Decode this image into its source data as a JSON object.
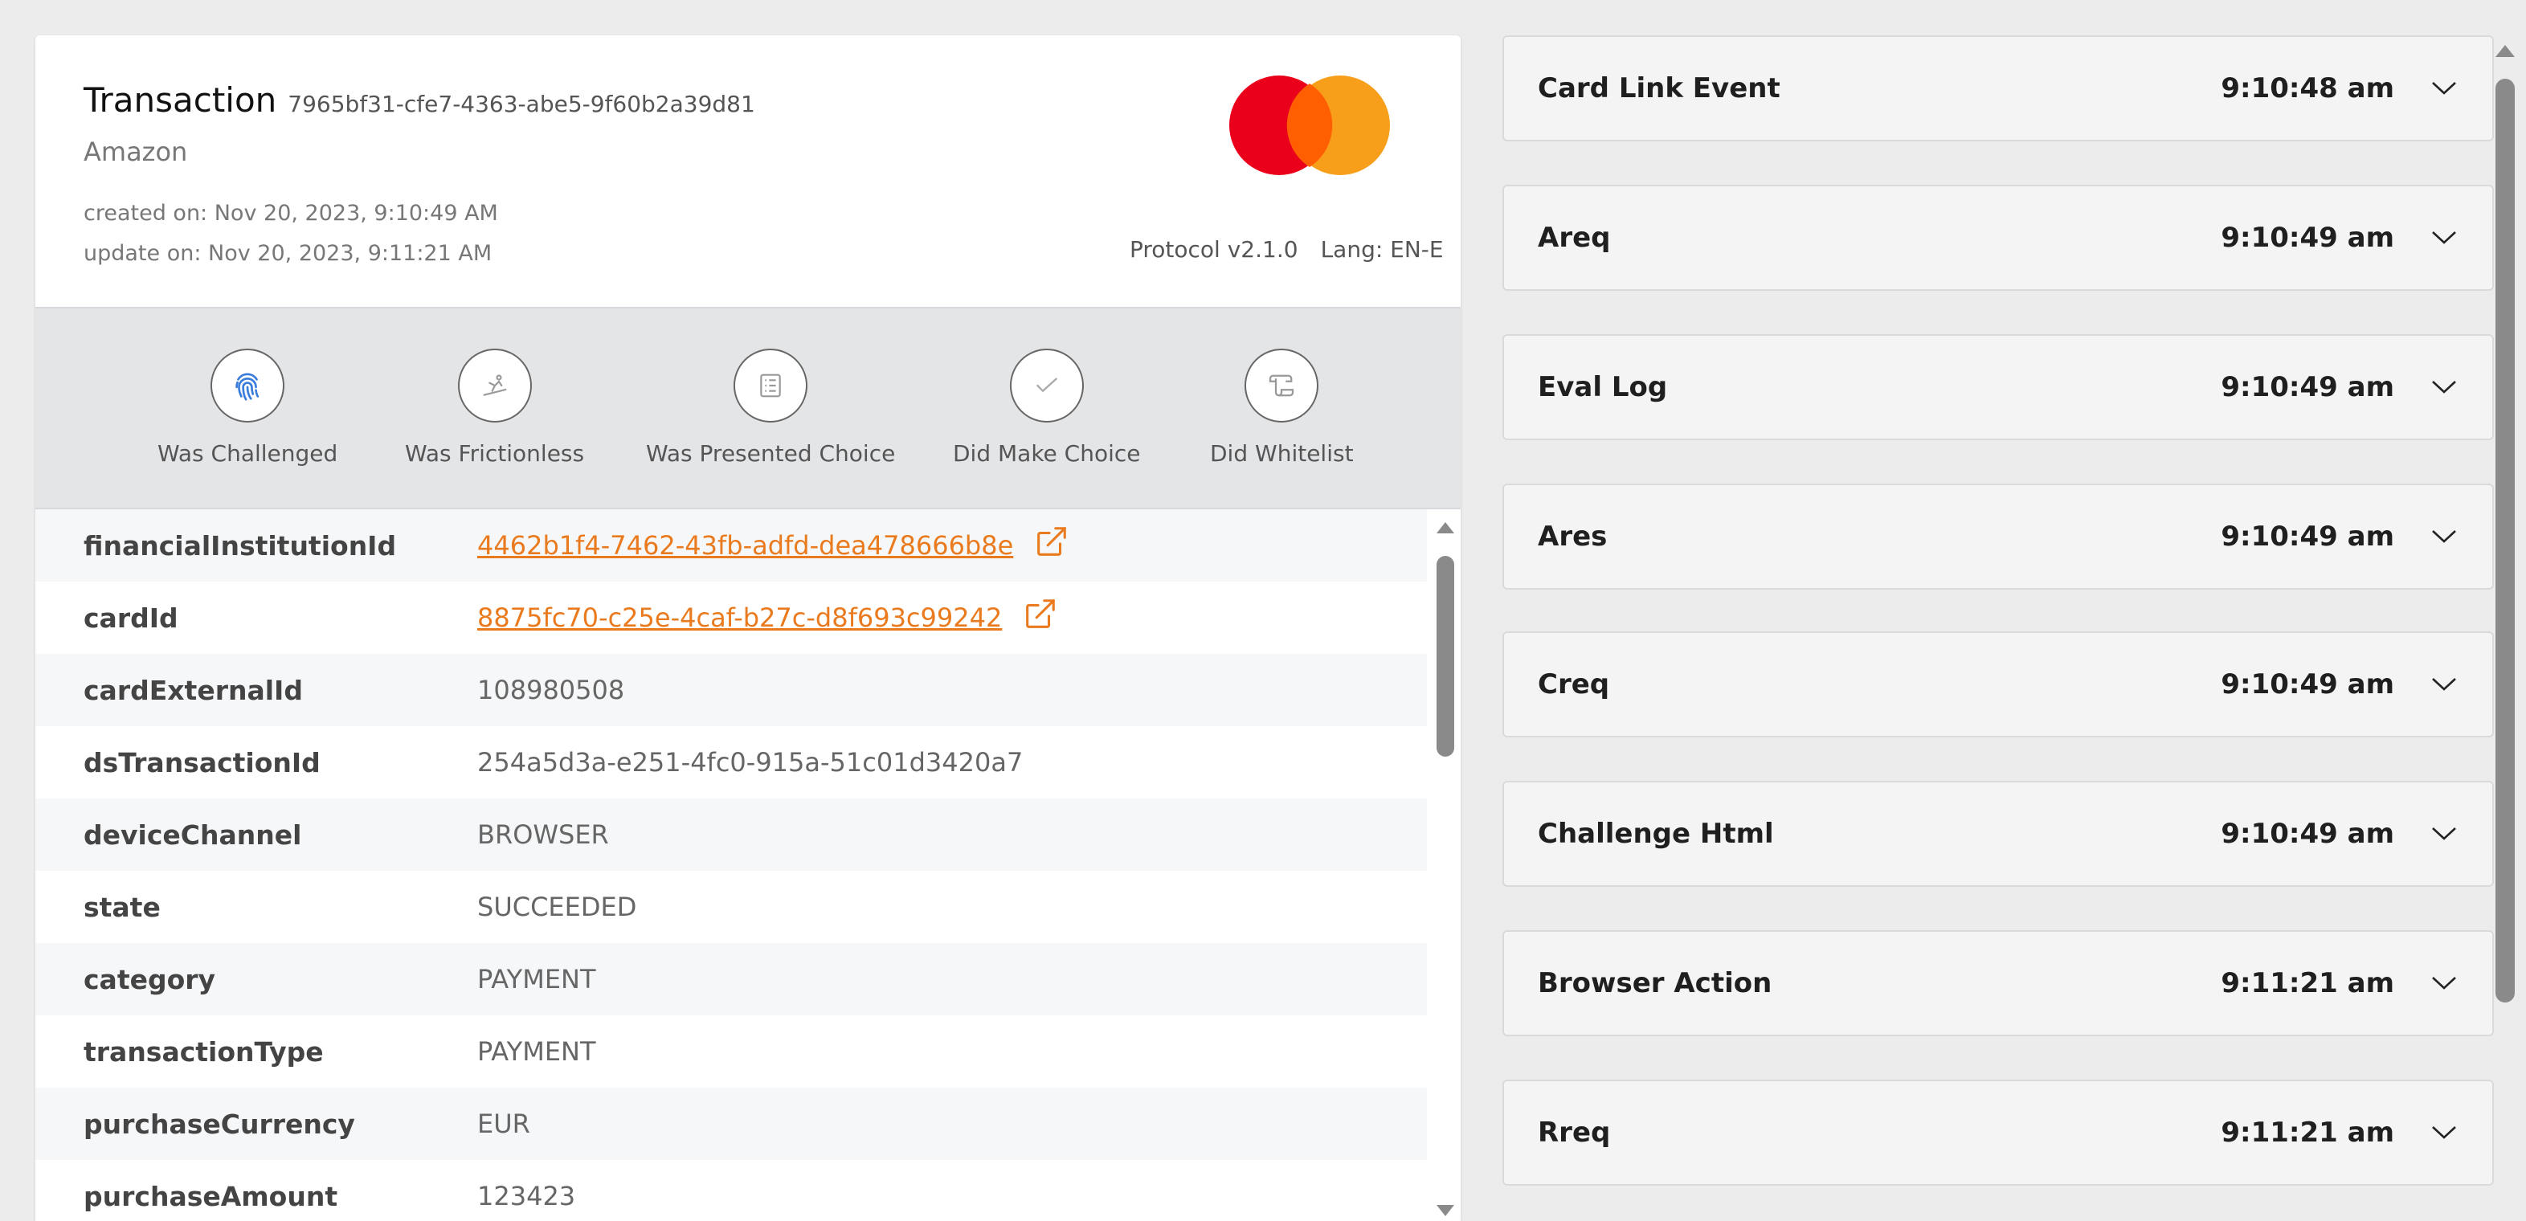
{
  "header": {
    "title": "Transaction",
    "transaction_id": "7965bf31-cfe7-4363-abe5-9f60b2a39d81",
    "merchant": "Amazon",
    "created": "created on: Nov 20, 2023, 9:10:49 AM",
    "updated": "update on: Nov 20, 2023, 9:11:21 AM",
    "protocol": "Protocol v2.1.0",
    "lang": "Lang: EN-E",
    "logo_icon": "mastercard-logo",
    "colors": {
      "brand_red": "#eb001b",
      "brand_orange": "#f79e1b",
      "link": "#ea7a1e"
    }
  },
  "flags": [
    {
      "label": "Was Challenged",
      "icon": "fingerprint-icon",
      "active": true
    },
    {
      "label": "Was Frictionless",
      "icon": "skier-icon",
      "active": false
    },
    {
      "label": "Was Presented Choice",
      "icon": "list-icon",
      "active": false
    },
    {
      "label": "Did Make Choice",
      "icon": "check-icon",
      "active": false
    },
    {
      "label": "Did Whitelist",
      "icon": "scroll-icon",
      "active": false
    }
  ],
  "details": [
    {
      "key": "financialInstitutionId",
      "value": "4462b1f4-7462-43fb-adfd-dea478666b8e",
      "link": true
    },
    {
      "key": "cardId",
      "value": "8875fc70-c25e-4caf-b27c-d8f693c99242",
      "link": true
    },
    {
      "key": "cardExternalId",
      "value": "108980508",
      "link": false
    },
    {
      "key": "dsTransactionId",
      "value": "254a5d3a-e251-4fc0-915a-51c01d3420a7",
      "link": false
    },
    {
      "key": "deviceChannel",
      "value": "BROWSER",
      "link": false
    },
    {
      "key": "state",
      "value": "SUCCEEDED",
      "link": false
    },
    {
      "key": "category",
      "value": "PAYMENT",
      "link": false
    },
    {
      "key": "transactionType",
      "value": "PAYMENT",
      "link": false
    },
    {
      "key": "purchaseCurrency",
      "value": "EUR",
      "link": false
    },
    {
      "key": "purchaseAmount",
      "value": "123423",
      "link": false
    }
  ],
  "events": [
    {
      "name": "Card Link Event",
      "time": "9:10:48 am"
    },
    {
      "name": "Areq",
      "time": "9:10:49 am"
    },
    {
      "name": "Eval Log",
      "time": "9:10:49 am"
    },
    {
      "name": "Ares",
      "time": "9:10:49 am"
    },
    {
      "name": "Creq",
      "time": "9:10:49 am"
    },
    {
      "name": "Challenge Html",
      "time": "9:10:49 am"
    },
    {
      "name": "Browser Action",
      "time": "9:11:21 am"
    },
    {
      "name": "Rreq",
      "time": "9:11:21 am"
    }
  ]
}
